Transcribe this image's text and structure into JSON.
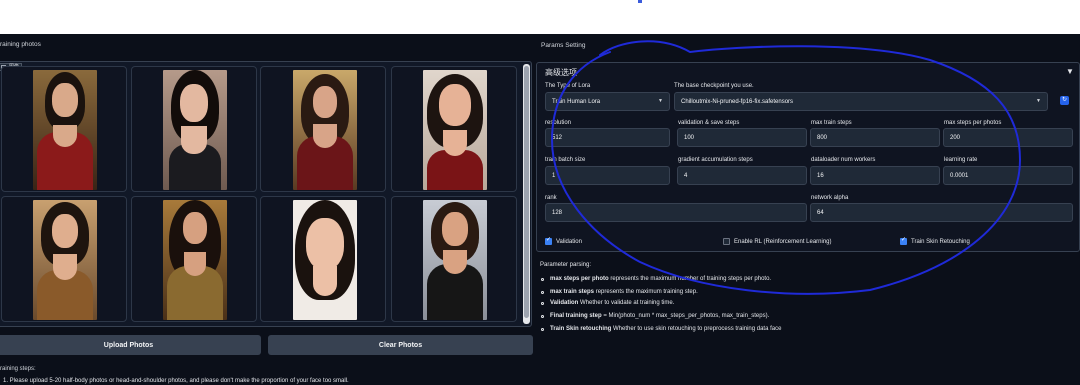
{
  "left": {
    "label": "raining photos",
    "gallery_tag": "图像",
    "upload_button": "Upload Photos",
    "clear_button": "Clear Photos",
    "steps_label": "raining steps:",
    "steps_text": "Please upload 5-20 half-body photos or head-and-shoulder photos, and please don't make the proportion of your face too small."
  },
  "params": {
    "label": "Params Setting",
    "panel_title": "高级选项",
    "lora_type": {
      "label": "The Type of Lora",
      "value": "Train Human Lora"
    },
    "checkpoint": {
      "label": "The base checkpoint you use.",
      "value": "Chilloutmix-Ni-pruned-fp16-fix.safetensors"
    },
    "resolution": {
      "label": "resolution",
      "value": "512"
    },
    "val_save_steps": {
      "label": "validation & save steps",
      "value": "100"
    },
    "max_train_steps": {
      "label": "max train steps",
      "value": "800"
    },
    "max_steps_per_photos": {
      "label": "max steps per photos",
      "value": "200"
    },
    "train_batch_size": {
      "label": "train batch size",
      "value": "1"
    },
    "grad_accum_steps": {
      "label": "gradient accumulation steps",
      "value": "4"
    },
    "dataloader_workers": {
      "label": "dataloader num workers",
      "value": "16"
    },
    "learning_rate": {
      "label": "learning rate",
      "value": "0.0001"
    },
    "rank": {
      "label": "rank",
      "value": "128"
    },
    "network_alpha": {
      "label": "network alpha",
      "value": "64"
    },
    "validation": {
      "label": "Validation",
      "checked": true
    },
    "enable_rl": {
      "label": "Enable RL (Reinforcement Learning)",
      "checked": false
    },
    "skin_retouching": {
      "label": "Train Skin Retouching",
      "checked": true
    }
  },
  "parsing": {
    "label": "Parameter parsing:",
    "items": [
      {
        "bold": "max steps per photo",
        "text": " represents the maximum number of training steps per photo."
      },
      {
        "bold": "max train steps",
        "text": " represents the maximum training step."
      },
      {
        "bold": "Validation",
        "text": " Whether to validate at training time."
      },
      {
        "bold": "Final training step",
        "text": " = Min(photo_num * max_steps_per_photos, max_train_steps)."
      },
      {
        "bold": "Train Skin retouching",
        "text": " Whether to use skin retouching to preprocess training data face"
      }
    ]
  },
  "colors": {
    "background": "#0b0f19",
    "panel": "#1f2937",
    "accent": "#3b82f6",
    "annotation": "#1f2ad8"
  },
  "icons": {
    "refresh": "refresh-icon",
    "dropdown": "chevron-down-icon",
    "collapse": "triangle-down-icon"
  }
}
